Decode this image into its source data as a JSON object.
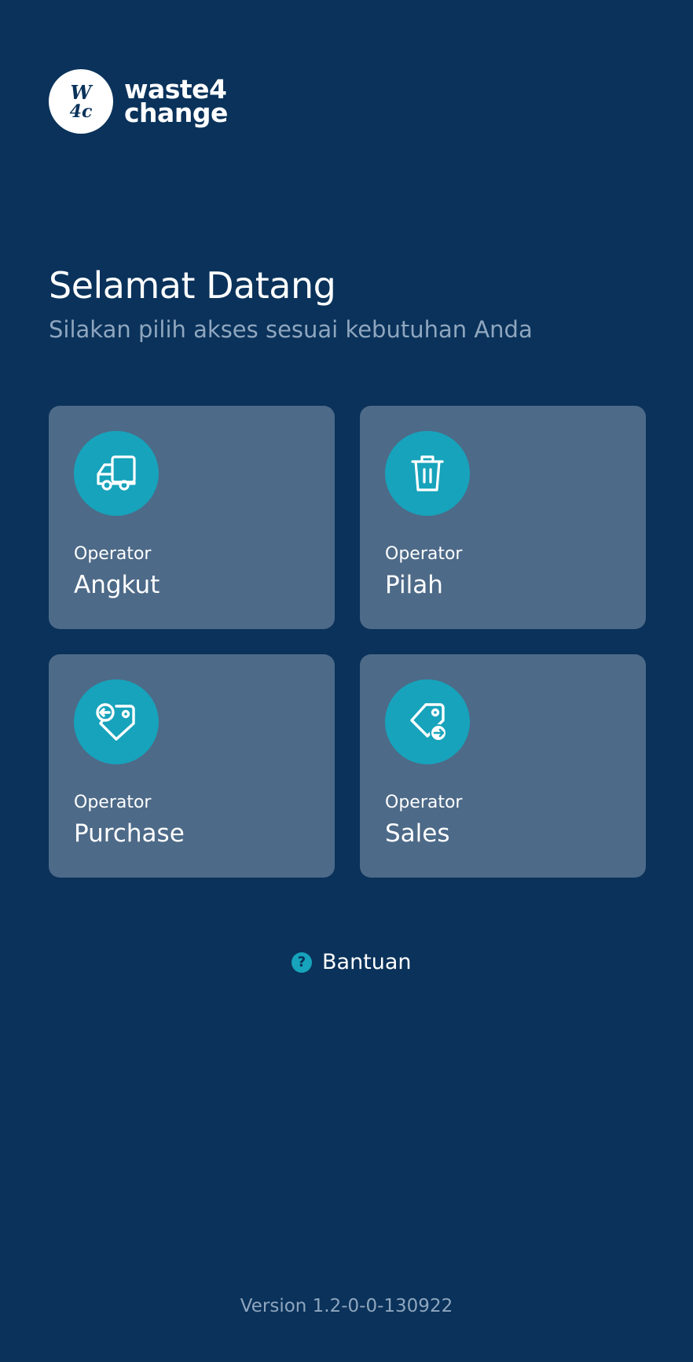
{
  "brand": {
    "mark_text": "W4C",
    "name_line1": "waste4",
    "name_line2": "change"
  },
  "header": {
    "title": "Selamat Datang",
    "subtitle": "Silakan pilih akses sesuai kebutuhan Anda"
  },
  "roles": [
    {
      "prefix": "Operator",
      "name": "Angkut",
      "icon": "truck-icon"
    },
    {
      "prefix": "Operator",
      "name": "Pilah",
      "icon": "trash-icon"
    },
    {
      "prefix": "Operator",
      "name": "Purchase",
      "icon": "tag-in-icon"
    },
    {
      "prefix": "Operator",
      "name": "Sales",
      "icon": "tag-out-icon"
    }
  ],
  "help": {
    "label": "Bantuan",
    "icon": "question-icon"
  },
  "footer": {
    "version": "Version 1.2-0-0-130922"
  },
  "colors": {
    "background": "#0a325a",
    "card": "#4d6a88",
    "accent": "#17a3bb",
    "muted_text": "#8fa6bf"
  }
}
